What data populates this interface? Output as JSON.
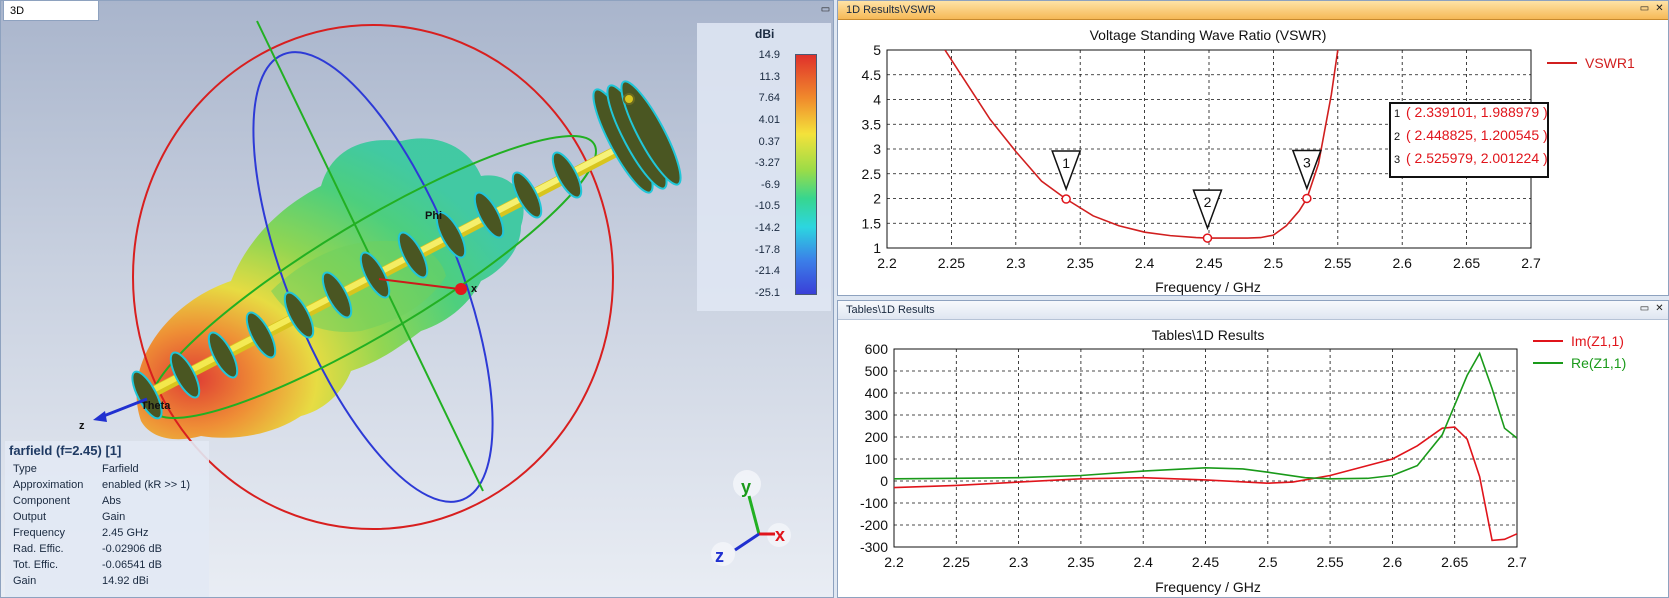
{
  "view3d": {
    "tab_label": "3D",
    "legend_unit": "dBi",
    "legend_ticks": [
      "14.9",
      "11.3",
      "7.64",
      "4.01",
      "0.37",
      "-3.27",
      "-6.9",
      "-10.5",
      "-14.2",
      "-17.8",
      "-21.4",
      "-25.1"
    ],
    "axis_x": "x",
    "axis_y": "y",
    "axis_z": "z",
    "label_phi": "Phi",
    "label_theta": "Theta",
    "info": {
      "title": "farfield (f=2.45) [1]",
      "rows": [
        {
          "k": "Type",
          "v": "Farfield"
        },
        {
          "k": "Approximation",
          "v": "enabled (kR >> 1)"
        },
        {
          "k": "Component",
          "v": "Abs"
        },
        {
          "k": "Output",
          "v": "Gain"
        },
        {
          "k": "Frequency",
          "v": "2.45 GHz"
        },
        {
          "k": "Rad. Effic.",
          "v": "-0.02906 dB"
        },
        {
          "k": "Tot. Effic.",
          "v": "-0.06541 dB"
        },
        {
          "k": "Gain",
          "v": "14.92 dBi"
        }
      ]
    }
  },
  "pane_vswr": {
    "title": "1D Results\\VSWR",
    "minimize_icon": "minimize-icon",
    "close_icon": "close-icon"
  },
  "pane_tables": {
    "title": "Tables\\1D Results",
    "minimize_icon": "minimize-icon",
    "close_icon": "close-icon"
  },
  "colors": {
    "vswr": "#d11f1f",
    "im": "#e0141b",
    "re": "#1a9a1a",
    "accent": "#f6b957"
  },
  "chart_data": [
    {
      "type": "line",
      "title": "Voltage Standing Wave Ratio (VSWR)",
      "xlabel": "Frequency / GHz",
      "ylabel": "",
      "xlim": [
        2.2,
        2.7
      ],
      "ylim": [
        1,
        5
      ],
      "xticks": [
        "2.2",
        "2.25",
        "2.3",
        "2.35",
        "2.4",
        "2.45",
        "2.5",
        "2.55",
        "2.6",
        "2.65",
        "2.7"
      ],
      "yticks": [
        "1",
        "1.5",
        "2",
        "2.5",
        "3",
        "3.5",
        "4",
        "4.5",
        "5"
      ],
      "grid": true,
      "legend_position": "top-right",
      "series": [
        {
          "name": "VSWR1",
          "x": [
            2.245,
            2.26,
            2.28,
            2.3,
            2.32,
            2.339,
            2.36,
            2.38,
            2.4,
            2.42,
            2.44,
            2.449,
            2.46,
            2.48,
            2.49,
            2.5,
            2.51,
            2.52,
            2.526,
            2.535,
            2.545,
            2.55
          ],
          "y": [
            5.0,
            4.4,
            3.6,
            2.95,
            2.35,
            1.99,
            1.65,
            1.45,
            1.32,
            1.25,
            1.21,
            1.2,
            1.2,
            1.2,
            1.21,
            1.26,
            1.45,
            1.75,
            2.0,
            2.7,
            4.1,
            5.0
          ]
        }
      ],
      "markers": [
        {
          "id": "1",
          "x": 2.339101,
          "y": 1.988979,
          "label": "( 2.339101, 1.988979 )"
        },
        {
          "id": "2",
          "x": 2.448825,
          "y": 1.200545,
          "label": "( 2.448825, 1.200545 )"
        },
        {
          "id": "3",
          "x": 2.525979,
          "y": 2.001224,
          "label": "( 2.525979, 2.001224 )"
        }
      ]
    },
    {
      "type": "line",
      "title": "Tables\\1D Results",
      "xlabel": "Frequency / GHz",
      "ylabel": "",
      "xlim": [
        2.2,
        2.7
      ],
      "ylim": [
        -300,
        600
      ],
      "xticks": [
        "2.2",
        "2.25",
        "2.3",
        "2.35",
        "2.4",
        "2.45",
        "2.5",
        "2.55",
        "2.6",
        "2.65",
        "2.7"
      ],
      "yticks": [
        "-300",
        "-200",
        "-100",
        "0",
        "100",
        "200",
        "300",
        "400",
        "500",
        "600"
      ],
      "grid": true,
      "legend_position": "top-right",
      "series": [
        {
          "name": "Im(Z1,1)",
          "x": [
            2.2,
            2.25,
            2.3,
            2.35,
            2.4,
            2.45,
            2.5,
            2.52,
            2.55,
            2.6,
            2.62,
            2.64,
            2.65,
            2.66,
            2.67,
            2.68,
            2.69,
            2.7
          ],
          "y": [
            -30,
            -20,
            -5,
            10,
            15,
            5,
            -10,
            -5,
            25,
            100,
            160,
            240,
            245,
            190,
            20,
            -270,
            -265,
            -240
          ]
        },
        {
          "name": "Re(Z1,1)",
          "x": [
            2.2,
            2.25,
            2.3,
            2.35,
            2.4,
            2.45,
            2.48,
            2.5,
            2.53,
            2.55,
            2.58,
            2.6,
            2.62,
            2.64,
            2.66,
            2.67,
            2.68,
            2.69,
            2.7
          ],
          "y": [
            10,
            12,
            15,
            25,
            45,
            60,
            55,
            40,
            15,
            10,
            12,
            25,
            70,
            210,
            480,
            580,
            420,
            240,
            195
          ]
        }
      ]
    }
  ]
}
